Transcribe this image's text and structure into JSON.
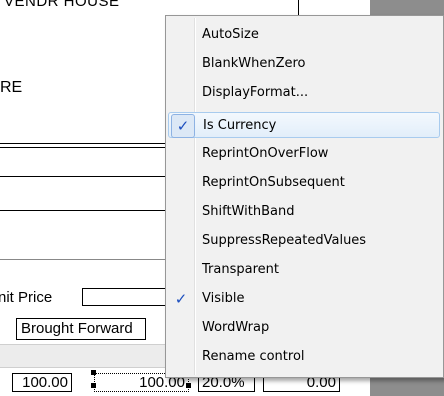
{
  "report": {
    "header_text": "VENDR HOUSE",
    "left_label": "RE",
    "unit_price_label": "nit Price",
    "brought_forward_label": "Brought Forward",
    "row_values": [
      "100.00",
      "100.00",
      "20.0%",
      "0.00"
    ]
  },
  "context_menu": {
    "items": [
      {
        "label": "AutoSize",
        "checked": false
      },
      {
        "label": "BlankWhenZero",
        "checked": false
      },
      {
        "label": "DisplayFormat...",
        "checked": false
      },
      {
        "label": "Is Currency",
        "checked": true,
        "highlighted": true
      },
      {
        "label": "ReprintOnOverFlow",
        "checked": false
      },
      {
        "label": "ReprintOnSubsequent",
        "checked": false
      },
      {
        "label": "ShiftWithBand",
        "checked": false
      },
      {
        "label": "SuppressRepeatedValues",
        "checked": false
      },
      {
        "label": "Transparent",
        "checked": false
      },
      {
        "label": "Visible",
        "checked": true
      },
      {
        "label": "WordWrap",
        "checked": false
      },
      {
        "label": "Rename control",
        "checked": false
      }
    ],
    "check_glyph": "✓",
    "highlight_color": "#e2eefa",
    "check_color": "#1d4fbf"
  }
}
